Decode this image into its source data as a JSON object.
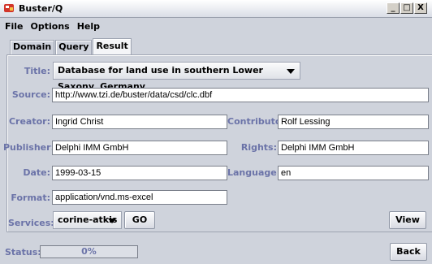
{
  "window": {
    "title": "Buster/Q",
    "minimize": "_",
    "maximize": "□",
    "close": "X"
  },
  "menu": [
    "File",
    "Options",
    "Help"
  ],
  "tabs": [
    "Domain",
    "Query",
    "Result"
  ],
  "active_tab": "Result",
  "form": {
    "title_label": "Title:",
    "title_value": "Database for land use in southern Lower Saxony, Germany",
    "source_label": "Source:",
    "source_value": "http://www.tzi.de/buster/data/csd/clc.dbf",
    "creator_label": "Creator:",
    "creator_value": "Ingrid Christ",
    "contributor_label": "Contributor:",
    "contributor_value": "Rolf Lessing",
    "publisher_label": "Publisher:",
    "publisher_value": "Delphi IMM GmbH",
    "rights_label": "Rights:",
    "rights_value": "Delphi IMM GmbH",
    "date_label": "Date:",
    "date_value": "1999-03-15",
    "language_label": "Language:",
    "language_value": "en",
    "format_label": "Format:",
    "format_value": "application/vnd.ms-excel",
    "services_label": "Services:",
    "services_value": "corine-atkis",
    "go_label": "GO",
    "view_label": "View"
  },
  "status": {
    "label": "Status:",
    "progress_text": "0%",
    "progress_fraction": 0.0
  },
  "back_label": "Back",
  "colors": {
    "label": "#6b73a8",
    "background": "#cfd3dc"
  }
}
